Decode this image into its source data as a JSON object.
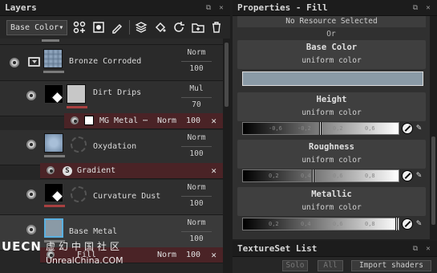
{
  "layers_panel": {
    "title": "Layers",
    "channel_dropdown": "Base Color",
    "layers": [
      {
        "name": "Bronze Corroded",
        "blend": "Norm",
        "opacity": "100"
      },
      {
        "name": "Dirt Drips",
        "blend": "Mul",
        "opacity": "70"
      },
      {
        "name": "Oxydation",
        "blend": "Norm",
        "opacity": "100"
      },
      {
        "name": "Curvature Dust",
        "blend": "Norm",
        "opacity": "100"
      },
      {
        "name": "Base Metal",
        "blend": "Norm",
        "opacity": "100"
      }
    ],
    "effects": [
      {
        "name": "MG Metal ⋯",
        "blend": "Norm",
        "opacity": "100"
      },
      {
        "name": "Gradient"
      },
      {
        "name": "Fill",
        "blend": "Norm",
        "opacity": "100"
      }
    ]
  },
  "properties_panel": {
    "title": "Properties - Fill",
    "no_resource": "No Resource Selected",
    "or_label": "Or",
    "channels": [
      {
        "title": "Base Color",
        "subtitle": "uniform color"
      },
      {
        "title": "Height",
        "subtitle": "uniform color"
      },
      {
        "title": "Roughness",
        "subtitle": "uniform color"
      },
      {
        "title": "Metallic",
        "subtitle": "uniform color"
      }
    ],
    "height_ticks": [
      "-0,6",
      "-0,2",
      "0,2",
      "0,6"
    ],
    "unit_ticks": [
      "0,2",
      "0,4",
      "0,6",
      "0,8"
    ],
    "base_color_hex": "#8a9aa6"
  },
  "texture_set_panel": {
    "title": "TextureSet List",
    "solo_label": "Solo",
    "all_label": "All",
    "import_label": "Import shaders"
  },
  "watermark": {
    "logo": "UECN",
    "chinese": "虚幻中国社区",
    "url": "UnrealChina.COM"
  }
}
